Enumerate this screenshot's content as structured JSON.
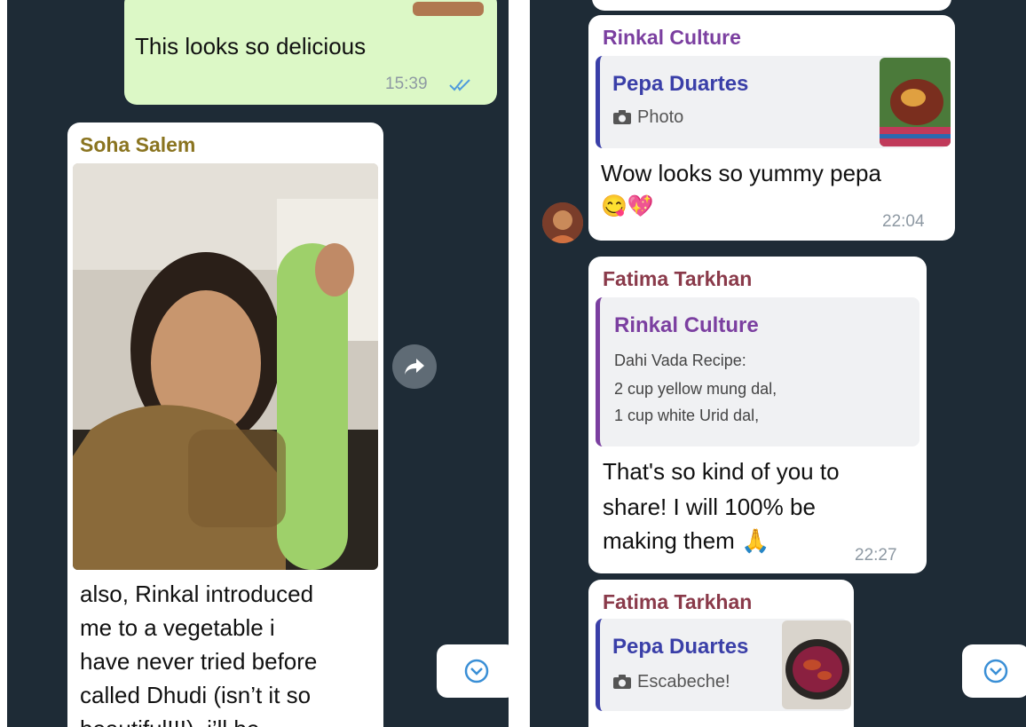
{
  "left": {
    "message_out": {
      "text": "This looks so delicious",
      "time": "15:39"
    },
    "message_photo": {
      "sender": "Soha Salem",
      "text_lines": [
        "also, Rinkal introduced",
        "me to a vegetable i",
        "have never tried before",
        "called Dhudi (isn’t it so",
        "beautiful!!!), i’ll be"
      ]
    }
  },
  "right": {
    "message_1": {
      "sender": "Rinkal Culture",
      "quote_name": "Pepa Duartes",
      "quote_sub": "Photo",
      "text": "Wow looks so yummy pepa",
      "emoji": "😋💖",
      "time": "22:04"
    },
    "message_2": {
      "sender": "Fatima Tarkhan",
      "quote_name": "Rinkal Culture",
      "quote_lines": [
        "Dahi Vada Recipe:",
        "2 cup yellow mung dal,",
        "1 cup white Urid dal,"
      ],
      "text_lines": [
        "That's so kind of you to",
        "share! I will 100% be",
        "making them 🙏"
      ],
      "time": "22:27"
    },
    "message_3": {
      "sender": "Fatima Tarkhan",
      "quote_name": "Pepa Duartes",
      "quote_sub": "Escabeche!"
    }
  },
  "colors": {
    "chat_background": "#1e2b36",
    "incoming_bubble": "#ffffff",
    "outgoing_bubble": "#dcf8c6",
    "sender_soha": "#8a7420",
    "sender_rinkal": "#7b3fa0",
    "sender_fatima": "#8a3a4a",
    "quote_name_pepa": "#3a3fa8",
    "quote_name_rinkal": "#7b3fa0",
    "read_ticks": "#4f9bdc",
    "accent_blue": "#3a8fd6"
  },
  "icons": {
    "read_receipt": "double-check-icon",
    "forward": "forward-arrow-icon",
    "scroll_down": "chevron-down-circle-icon",
    "camera": "camera-icon"
  }
}
